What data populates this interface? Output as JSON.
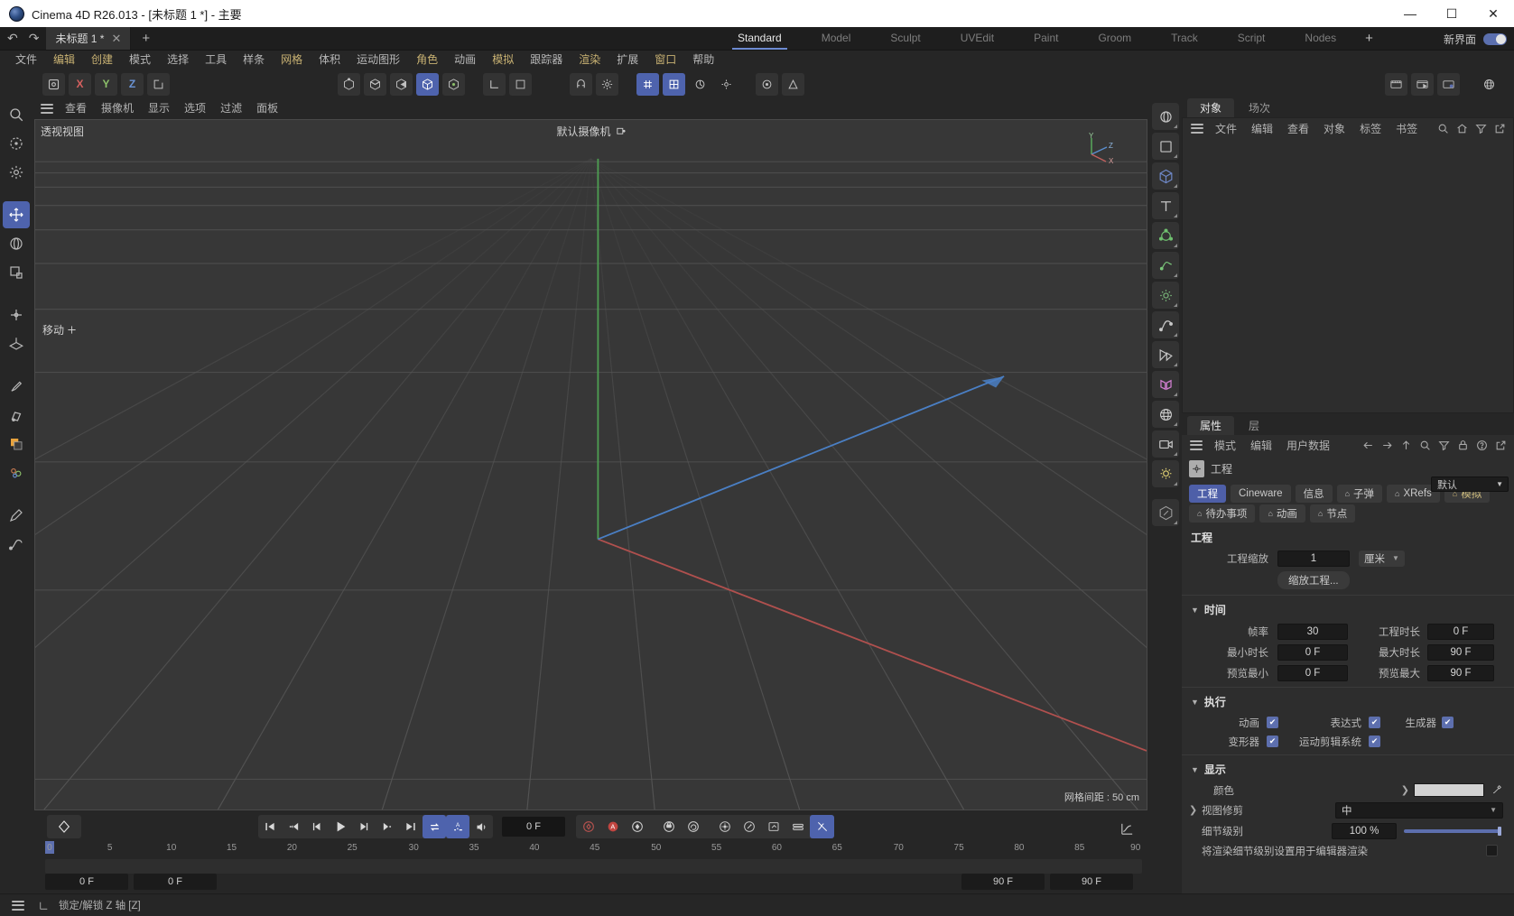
{
  "window": {
    "title": "Cinema 4D R26.013 - [未标题 1 *] - 主要",
    "minimize": "—",
    "maximize": "☐",
    "close": "✕"
  },
  "doc_tabs": {
    "undo": "↶",
    "redo": "↷",
    "name": "未标题 1 *",
    "close": "✕",
    "add": "+"
  },
  "layouts": {
    "tabs": [
      "Standard",
      "Model",
      "Sculpt",
      "UVEdit",
      "Paint",
      "Groom",
      "Track",
      "Script",
      "Nodes"
    ],
    "active": "Standard",
    "add": "+",
    "new_ui_label": "新界面"
  },
  "menubar": {
    "items": [
      {
        "label": "文件",
        "hl": false
      },
      {
        "label": "编辑",
        "hl": true
      },
      {
        "label": "创建",
        "hl": true
      },
      {
        "label": "模式",
        "hl": false
      },
      {
        "label": "选择",
        "hl": false
      },
      {
        "label": "工具",
        "hl": false
      },
      {
        "label": "样条",
        "hl": false
      },
      {
        "label": "网格",
        "hl": true
      },
      {
        "label": "体积",
        "hl": false
      },
      {
        "label": "运动图形",
        "hl": false
      },
      {
        "label": "角色",
        "hl": true
      },
      {
        "label": "动画",
        "hl": false
      },
      {
        "label": "模拟",
        "hl": true
      },
      {
        "label": "跟踪器",
        "hl": false
      },
      {
        "label": "渲染",
        "hl": true
      },
      {
        "label": "扩展",
        "hl": false
      },
      {
        "label": "窗口",
        "hl": true
      },
      {
        "label": "帮助",
        "hl": false
      }
    ]
  },
  "toolbar": {
    "axis_x": "X",
    "axis_y": "Y",
    "axis_z": "Z"
  },
  "viewport": {
    "menu": [
      "查看",
      "摄像机",
      "显示",
      "选项",
      "过滤",
      "面板"
    ],
    "view_name": "透视视图",
    "camera_name": "默认摄像机",
    "grid_info": "网格间距 : 50 cm",
    "tool_hint": "移动",
    "gizmo": {
      "y": "Y",
      "z": "Z",
      "x": "X"
    }
  },
  "timeline": {
    "ticks": [
      "0",
      "5",
      "10",
      "15",
      "20",
      "25",
      "30",
      "35",
      "40",
      "45",
      "50",
      "55",
      "60",
      "65",
      "70",
      "75",
      "80",
      "85",
      "90"
    ],
    "current_frame": "0 F",
    "start_field": "0 F",
    "start_field2": "0 F",
    "end_field": "90 F",
    "end_field2": "90 F"
  },
  "object_manager": {
    "tabs": [
      "对象",
      "场次"
    ],
    "active_tab": "对象",
    "menu": [
      "文件",
      "编辑",
      "查看",
      "对象",
      "标签",
      "书签"
    ]
  },
  "attribute_manager": {
    "tabs": [
      "属性",
      "层"
    ],
    "active_tab": "属性",
    "menu": [
      "模式",
      "编辑",
      "用户数据"
    ],
    "object_title": "工程",
    "preset": "默认",
    "chips_row1": [
      {
        "label": "工程",
        "active": true,
        "bell": false
      },
      {
        "label": "Cineware",
        "active": false,
        "bell": false
      },
      {
        "label": "信息",
        "active": false,
        "bell": false
      },
      {
        "label": "子弹",
        "active": false,
        "bell": true
      },
      {
        "label": "XRefs",
        "active": false,
        "bell": true
      },
      {
        "label": "模拟",
        "active": false,
        "bell": true,
        "yellow": true
      }
    ],
    "chips_row2": [
      {
        "label": "待办事项",
        "active": false,
        "bell": true
      },
      {
        "label": "动画",
        "active": false,
        "bell": true
      },
      {
        "label": "节点",
        "active": false,
        "bell": true
      }
    ],
    "project": {
      "section_title": "工程",
      "scale_label": "工程缩放",
      "scale_value": "1",
      "unit_value": "厘米",
      "scale_button": "缩放工程..."
    },
    "time": {
      "section_title": "时间",
      "fps_label": "帧率",
      "fps_value": "30",
      "duration_label": "工程时长",
      "duration_value": "0 F",
      "min_label": "最小时长",
      "min_value": "0 F",
      "max_label": "最大时长",
      "max_value": "90 F",
      "prev_min_label": "预览最小",
      "prev_min_value": "0 F",
      "prev_max_label": "预览最大",
      "prev_max_value": "90 F"
    },
    "execution": {
      "section_title": "执行",
      "items": [
        {
          "label": "动画",
          "checked": true
        },
        {
          "label": "表达式",
          "checked": true
        },
        {
          "label": "生成器",
          "checked": true
        },
        {
          "label": "变形器",
          "checked": true
        },
        {
          "label": "运动剪辑系统",
          "checked": true
        }
      ]
    },
    "display": {
      "section_title": "显示",
      "color_label": "颜色",
      "color_value": "#d2d2d2",
      "clip_label": "视图修剪",
      "clip_value": "中",
      "lod_label": "细节级别",
      "lod_value": "100 %",
      "render_lod_label": "将渲染细节级别设置用于编辑器渲染",
      "render_lod_checked": false
    }
  },
  "statusbar": {
    "text": "锁定/解锁 Z 轴 [Z]"
  },
  "colors": {
    "accent": "#5d6fae",
    "menu_highlight": "#c9b273",
    "axis_x": "#d4605f",
    "axis_y": "#8cc06a",
    "axis_z": "#6a93d4",
    "viewport_bg": "#373737",
    "panel_bg": "#2d2d2d",
    "app_bg": "#262626"
  }
}
